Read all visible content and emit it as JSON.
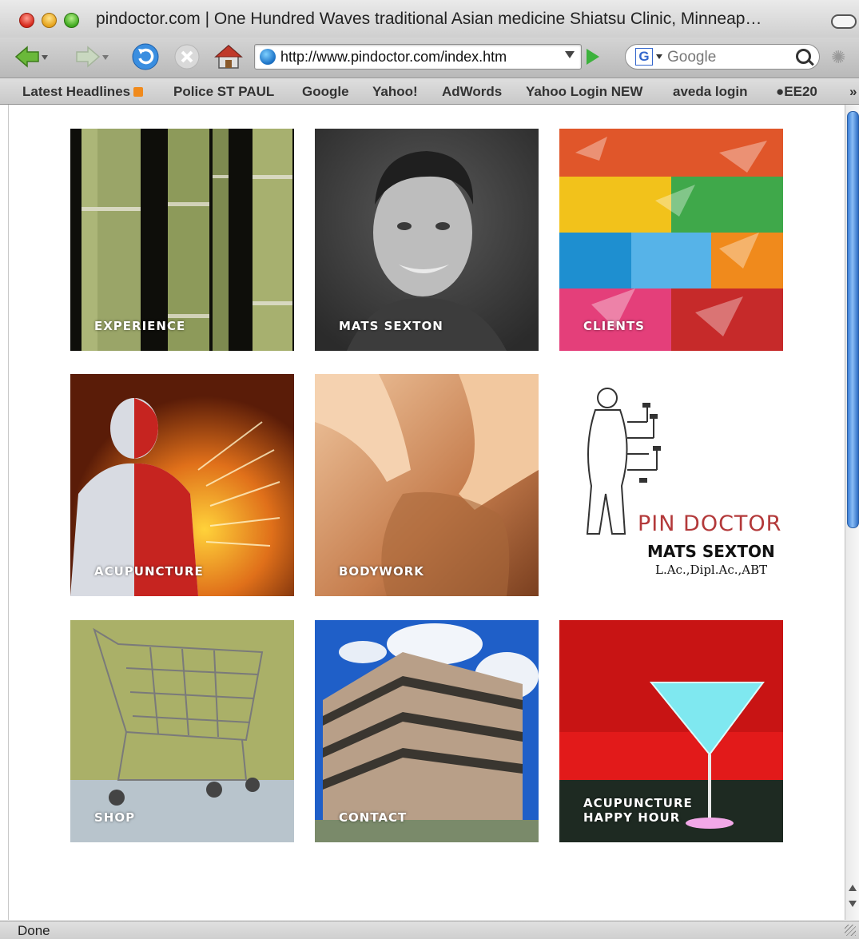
{
  "window": {
    "title": "pindoctor.com | One Hundred Waves traditional Asian medicine Shiatsu Clinic, Minneap…"
  },
  "toolbar": {
    "back_icon": "back-arrow-icon",
    "forward_icon": "forward-arrow-icon",
    "reload_icon": "reload-icon",
    "stop_icon": "stop-icon",
    "home_icon": "home-icon",
    "url": "http://www.pindoctor.com/index.htm",
    "search_placeholder": "Google"
  },
  "bookmarks": [
    {
      "label": "Latest Headlines",
      "rss": true
    },
    {
      "label": "Police ST PAUL"
    },
    {
      "label": "Google"
    },
    {
      "label": "Yahoo!"
    },
    {
      "label": "AdWords"
    },
    {
      "label": "Yahoo Login NEW"
    },
    {
      "label": "aveda login"
    },
    {
      "label": "●EE20"
    }
  ],
  "bookmarks_overflow": "»",
  "tiles": [
    {
      "label": "EXPERIENCE"
    },
    {
      "label": "MATS SEXTON"
    },
    {
      "label": "CLIENTS"
    },
    {
      "label": "ACUPUNCTURE"
    },
    {
      "label": "BODYWORK"
    },
    {
      "label": ""
    },
    {
      "label": "SHOP"
    },
    {
      "label": "CONTACT"
    },
    {
      "label": "ACUPUNCTURE\nHAPPY HOUR"
    }
  ],
  "logo": {
    "title": "PIN DOCTOR",
    "name": "MATS SEXTON",
    "credentials": "L.Ac.,Dipl.Ac.,ABT"
  },
  "status": {
    "text": "Done"
  },
  "colors": {
    "logo_red": "#b3393a",
    "scroll_blue": "#3d80d8"
  }
}
